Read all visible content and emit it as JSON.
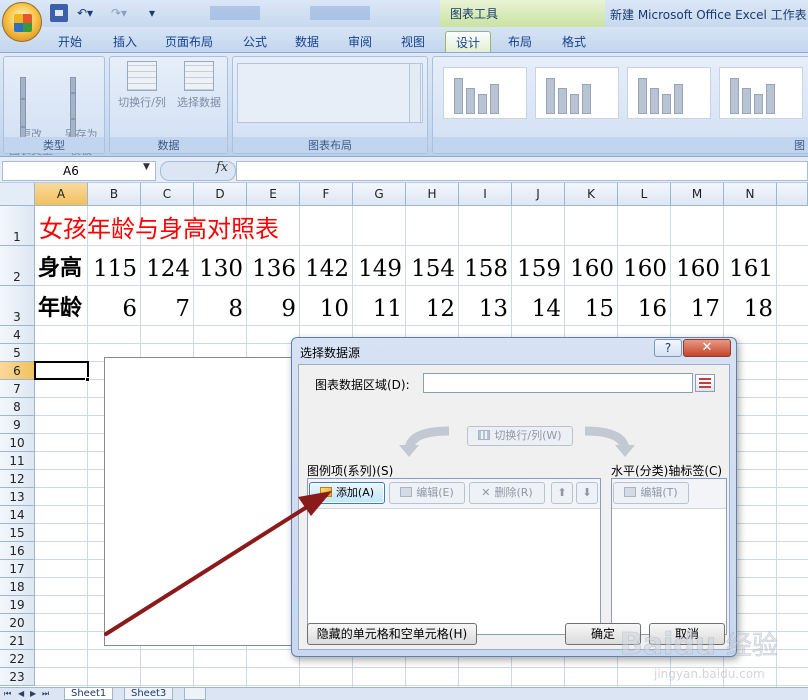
{
  "title_bar": {
    "context_tools_label": "图表工具",
    "app_title": "新建 Microsoft Office Excel 工作表"
  },
  "ribbon": {
    "tabs": [
      {
        "label": "开始",
        "active": false
      },
      {
        "label": "插入",
        "active": false
      },
      {
        "label": "页面布局",
        "active": false
      },
      {
        "label": "公式",
        "active": false
      },
      {
        "label": "数据",
        "active": false
      },
      {
        "label": "审阅",
        "active": false
      },
      {
        "label": "视图",
        "active": false
      },
      {
        "label": "设计",
        "active": true
      },
      {
        "label": "布局",
        "active": false
      },
      {
        "label": "格式",
        "active": false
      }
    ],
    "groups": {
      "type": {
        "label": "类型",
        "change_chart_type": "更改\n图表类型",
        "save_as_template": "另存为\n模板"
      },
      "data": {
        "label": "数据",
        "switch_row_col": "切换行/列",
        "select_data": "选择数据"
      },
      "chart_layouts": {
        "label": "图表布局"
      },
      "chart_styles": {
        "label": "图"
      }
    }
  },
  "formula_bar": {
    "name_box": "A6",
    "fx_label": "fx",
    "formula": ""
  },
  "sheet": {
    "columns": [
      "A",
      "B",
      "C",
      "D",
      "E",
      "F",
      "G",
      "H",
      "I",
      "J",
      "K",
      "L",
      "M",
      "N"
    ],
    "selected_column": "A",
    "rows": [
      "1",
      "2",
      "3",
      "4",
      "5",
      "6",
      "7",
      "8",
      "9",
      "10",
      "11",
      "12",
      "13",
      "14",
      "15",
      "16",
      "17",
      "18",
      "19",
      "20",
      "21",
      "22",
      "23"
    ],
    "selected_row": "6",
    "active_cell": "A6",
    "title": "女孩年龄与身高对照表",
    "height_row": {
      "label": "身高",
      "values": [
        "115",
        "124",
        "130",
        "136",
        "142",
        "149",
        "154",
        "158",
        "159",
        "160",
        "160",
        "160",
        "161"
      ]
    },
    "age_row": {
      "label": "年龄",
      "values": [
        "6",
        "7",
        "8",
        "9",
        "10",
        "11",
        "12",
        "13",
        "14",
        "15",
        "16",
        "17",
        "18"
      ]
    },
    "tabs": [
      {
        "label": "Sheet1",
        "active": true
      },
      {
        "label": "Sheet3",
        "active": false
      }
    ]
  },
  "dialog": {
    "title": "选择数据源",
    "help_label": "?",
    "close_label": "✕",
    "range_label": "图表数据区域(D):",
    "range_value": "",
    "switch_label": "切换行/列(W)",
    "series_label": "图例项(系列)(S)",
    "add_label": "添加(A)",
    "edit_label": "编辑(E)",
    "delete_label": "删除(R)",
    "axis_label": "水平(分类)轴标签(C)",
    "axis_edit_label": "编辑(T)",
    "hidden_cells_label": "隐藏的单元格和空单元格(H)",
    "ok_label": "确定",
    "cancel_label": "取消"
  },
  "annotation": {
    "color": "#8b1a1a"
  },
  "watermark": {
    "text": "Baidu 经验",
    "sub": "jingyan.baidu.com"
  },
  "colors": {
    "title_red": "#ff0000",
    "ribbon_blue": "#c9daf0",
    "arrow": "#8b1a1a"
  }
}
